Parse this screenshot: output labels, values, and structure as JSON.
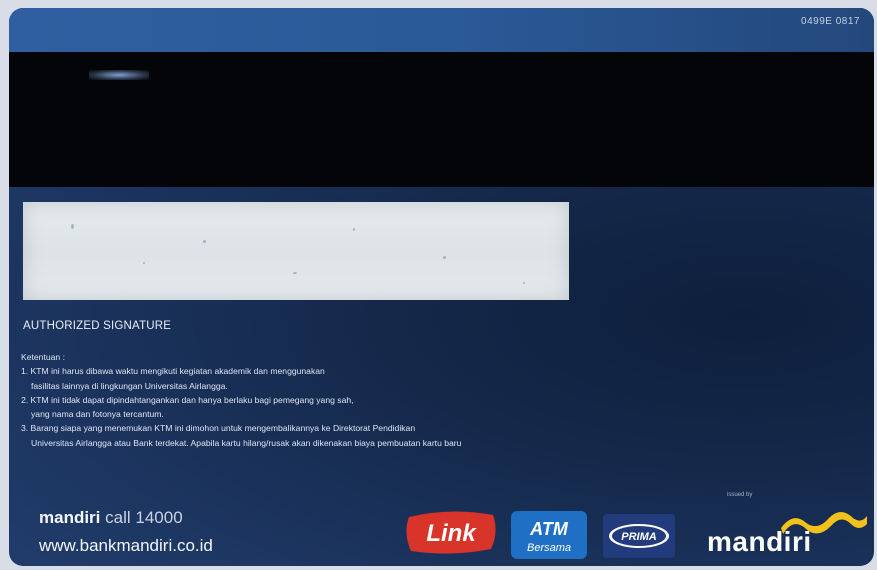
{
  "card": {
    "number": "0499E 0817",
    "signature_label": "AUTHORIZED SIGNATURE",
    "terms_heading": "Ketentuan :",
    "terms_lines": [
      "1. KTM ini harus dibawa waktu mengikuti kegiatan akademik dan menggunakan",
      "fasilitas lainnya di lingkungan Universitas Airlangga.",
      "2. KTM ini tidak dapat dipindahtangankan dan hanya berlaku bagi pemegang yang sah,",
      "yang nama dan fotonya tercantum.",
      "3. Barang siapa yang menemukan KTM ini dimohon untuk mengembalikannya ke Direktorat Pendidikan",
      "Universitas Airlangga atau Bank terdekat. Apabila kartu hilang/rusak akan dikenakan biaya pembuatan kartu baru"
    ],
    "call_brand": "mandiri",
    "call_text": "call 14000",
    "website": "www.bankmandiri.co.id",
    "issued_by": "issued by",
    "logos": {
      "link": "Link",
      "atm_top": "ATM",
      "atm_bottom": "Bersama",
      "prima": "PRIMA",
      "mandiri": "mandiri"
    },
    "colors": {
      "card_blue": "#1c3560",
      "link_red": "#d8342a",
      "atm_blue": "#1f6fc4",
      "prima_blue": "#213b7c",
      "mandiri_gold": "#f2c21b"
    }
  }
}
